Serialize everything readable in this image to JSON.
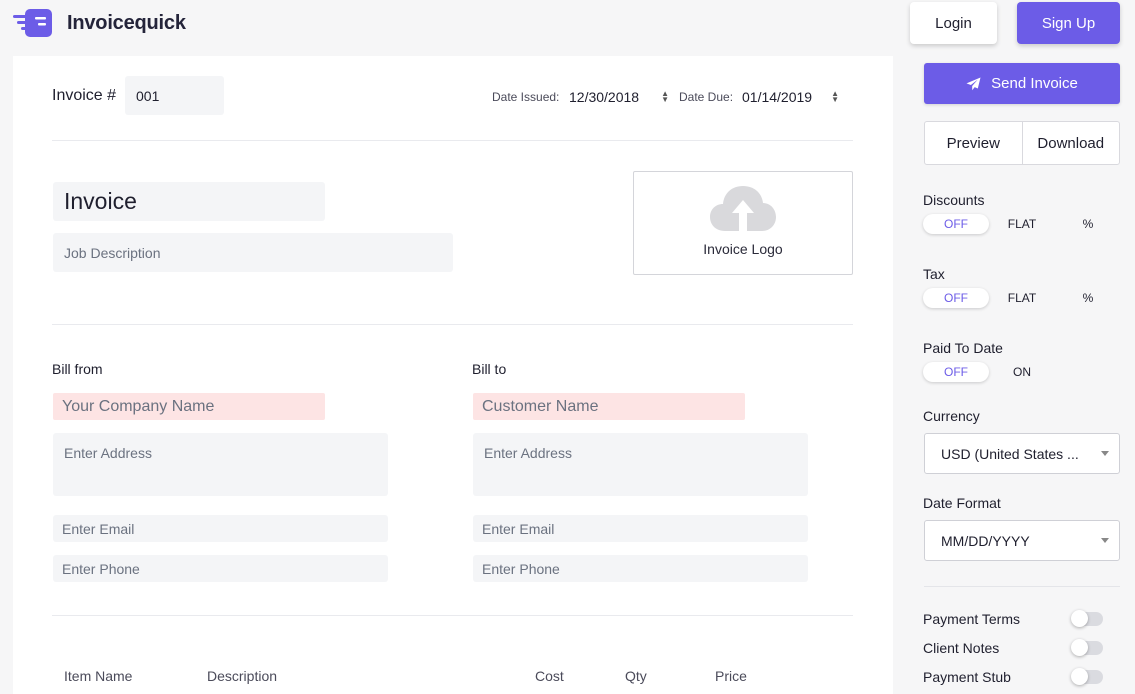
{
  "brand": {
    "name": "Invoicequick",
    "accent": "#6c5ce7"
  },
  "header": {
    "login_label": "Login",
    "signup_label": "Sign Up"
  },
  "invoice": {
    "number_label": "Invoice #",
    "number_value": "001",
    "date_issued_label": "Date Issued:",
    "date_issued_value": "12/30/2018",
    "date_due_label": "Date Due:",
    "date_due_value": "01/14/2019",
    "title_value": "Invoice",
    "job_description_placeholder": "Job Description",
    "logo_label": "Invoice Logo"
  },
  "bill_from": {
    "heading": "Bill from",
    "company_placeholder": "Your Company Name",
    "address_placeholder": "Enter Address",
    "email_placeholder": "Enter Email",
    "phone_placeholder": "Enter Phone"
  },
  "bill_to": {
    "heading": "Bill to",
    "customer_placeholder": "Customer Name",
    "address_placeholder": "Enter Address",
    "email_placeholder": "Enter Email",
    "phone_placeholder": "Enter Phone"
  },
  "items_table": {
    "columns": [
      "Item Name",
      "Description",
      "Cost",
      "Qty",
      "Price"
    ]
  },
  "sidebar": {
    "send_label": "Send Invoice",
    "preview_label": "Preview",
    "download_label": "Download",
    "discounts": {
      "title": "Discounts",
      "options": [
        "OFF",
        "FLAT",
        "%"
      ],
      "selected": "OFF"
    },
    "tax": {
      "title": "Tax",
      "options": [
        "OFF",
        "FLAT",
        "%"
      ],
      "selected": "OFF"
    },
    "paid_to_date": {
      "title": "Paid To Date",
      "options": [
        "OFF",
        "ON"
      ],
      "selected": "OFF"
    },
    "currency": {
      "title": "Currency",
      "value": "USD (United States ..."
    },
    "date_format": {
      "title": "Date Format",
      "value": "MM/DD/YYYY"
    },
    "toggles": [
      {
        "label": "Payment Terms",
        "on": false
      },
      {
        "label": "Client Notes",
        "on": false
      },
      {
        "label": "Payment Stub",
        "on": false
      }
    ]
  }
}
